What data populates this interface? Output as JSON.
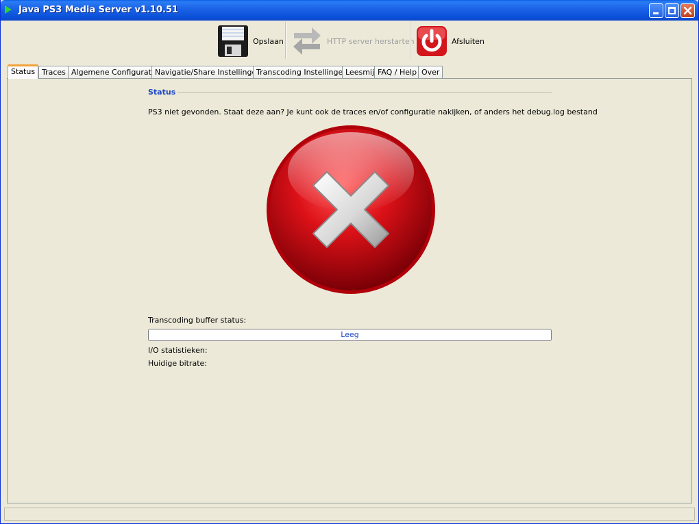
{
  "window": {
    "title": "Java PS3 Media Server v1.10.51"
  },
  "toolbar": {
    "save_label": "Opslaan",
    "restart_label": "HTTP server herstarten",
    "quit_label": "Afsluiten"
  },
  "tabs": [
    {
      "label": "Status",
      "active": true
    },
    {
      "label": "Traces"
    },
    {
      "label": "Algemene Configuratie"
    },
    {
      "label": "Navigatie/Share Instellingen"
    },
    {
      "label": "Transcoding Instellingen"
    },
    {
      "label": "Leesmij"
    },
    {
      "label": "FAQ / Help"
    },
    {
      "label": "Over"
    }
  ],
  "status": {
    "section_title": "Status",
    "message": "PS3 niet gevonden. Staat deze aan? Je kunt ook de traces en/of configuratie nakijken, of anders het debug.log bestand",
    "status_icon": "error-x-icon",
    "buffer_label": "Transcoding buffer status:",
    "buffer_text": "Leeg",
    "buffer_progress": 0,
    "io_label": "I/O statistieken:",
    "bitrate_label": "Huidige bitrate:"
  },
  "colors": {
    "accent": "#1b47c4",
    "titlebar": "#0a4fd8",
    "error_red": "#d4111a",
    "tab_highlight": "#f0a33a"
  }
}
